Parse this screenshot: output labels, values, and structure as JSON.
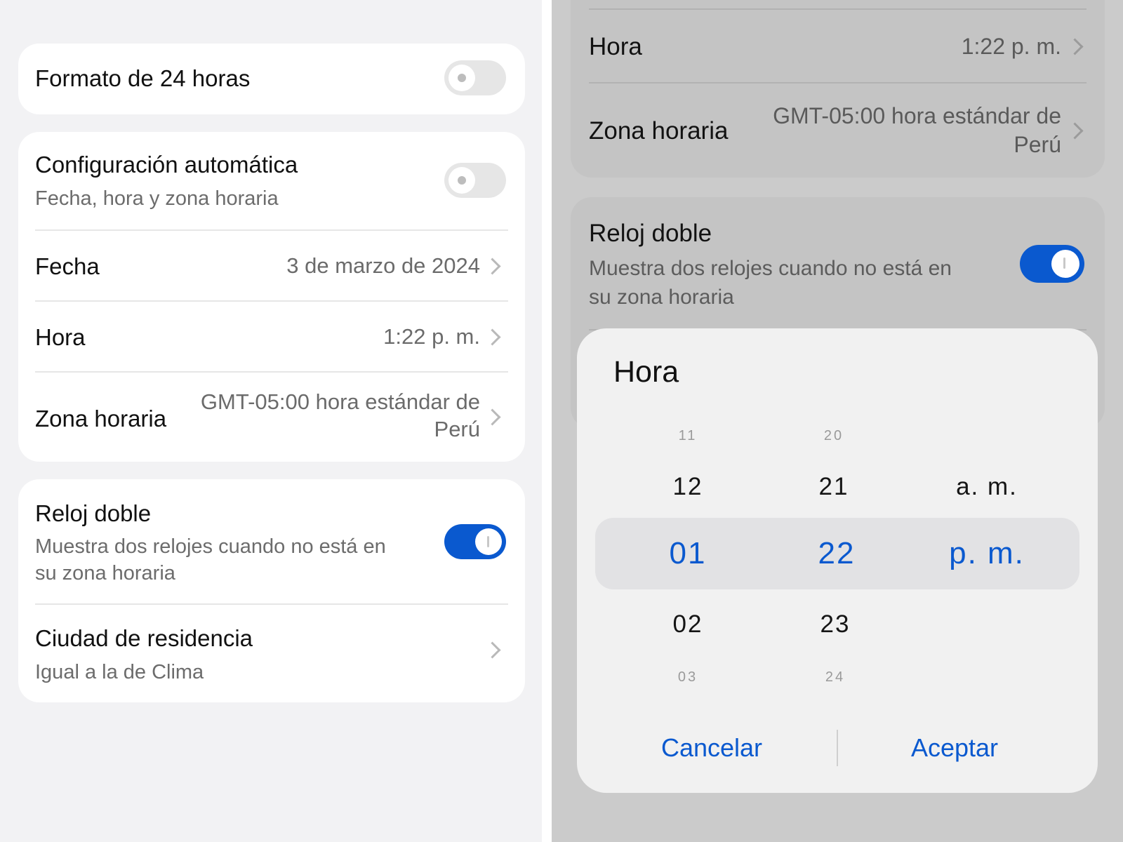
{
  "left": {
    "format24": {
      "label": "Formato de 24 horas",
      "enabled": false
    },
    "auto_config": {
      "label": "Configuración automática",
      "sublabel": "Fecha, hora y zona horaria",
      "enabled": false
    },
    "date": {
      "label": "Fecha",
      "value": "3 de marzo de 2024"
    },
    "time": {
      "label": "Hora",
      "value": "1:22 p. m."
    },
    "timezone": {
      "label": "Zona horaria",
      "value_line1": "GMT-05:00 hora estándar de",
      "value_line2": "Perú"
    },
    "dual_clock": {
      "label": "Reloj doble",
      "sub_line1": "Muestra dos relojes cuando no está en",
      "sub_line2": "su zona horaria",
      "enabled": true
    },
    "home_city": {
      "label": "Ciudad de residencia",
      "sublabel": "Igual a la de Clima"
    }
  },
  "right": {
    "time": {
      "label": "Hora",
      "value": "1:22 p. m."
    },
    "timezone": {
      "label": "Zona horaria",
      "value_line1": "GMT-05:00 hora estándar de",
      "value_line2": "Perú"
    },
    "dual_clock": {
      "label": "Reloj doble",
      "sub_line1": "Muestra dos relojes cuando no está en",
      "sub_line2": "su zona horaria",
      "enabled": true
    },
    "dialog": {
      "title": "Hora",
      "hours": {
        "above2": "11",
        "above1": "12",
        "selected": "01",
        "below1": "02",
        "below2": "03"
      },
      "minutes": {
        "above2": "20",
        "above1": "21",
        "selected": "22",
        "below1": "23",
        "below2": "24"
      },
      "ampm": {
        "above1": "a. m.",
        "selected": "p. m."
      },
      "cancel": "Cancelar",
      "accept": "Aceptar"
    }
  },
  "colors": {
    "accent": "#0a59cf",
    "left_bg": "#f2f2f4",
    "dim_bg": "#cbcbcb"
  }
}
